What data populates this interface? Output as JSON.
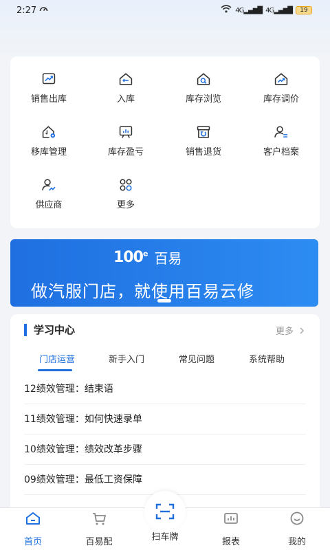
{
  "status_bar": {
    "time": "2:27",
    "signal_1": "4G",
    "signal_2": "4G",
    "battery": "19"
  },
  "menu": {
    "items": [
      {
        "label": "销售出库",
        "icon": "sales-outbound-icon"
      },
      {
        "label": "入库",
        "icon": "inbound-icon"
      },
      {
        "label": "库存浏览",
        "icon": "inventory-browse-icon"
      },
      {
        "label": "库存调价",
        "icon": "inventory-price-icon"
      },
      {
        "label": "移库管理",
        "icon": "transfer-icon"
      },
      {
        "label": "库存盈亏",
        "icon": "inventory-profit-icon"
      },
      {
        "label": "销售退货",
        "icon": "sales-return-icon"
      },
      {
        "label": "客户档案",
        "icon": "customer-file-icon"
      },
      {
        "label": "供应商",
        "icon": "supplier-icon"
      },
      {
        "label": "更多",
        "icon": "more-icon"
      }
    ]
  },
  "banner": {
    "logo_number": "100",
    "logo_sup": "e",
    "logo_brand": "百易",
    "slogan": "做汽服门店，就使用百易云修"
  },
  "learning": {
    "title": "学习中心",
    "more": "更多",
    "tabs": [
      "门店运营",
      "新手入门",
      "常见问题",
      "系统帮助"
    ],
    "articles": [
      "12绩效管理：结束语",
      "11绩效管理：如何快速录单",
      "10绩效管理：绩效改革步骤",
      "09绩效管理：最低工资保障"
    ]
  },
  "nav": {
    "items": [
      {
        "label": "首页",
        "icon": "home-icon"
      },
      {
        "label": "百易配",
        "icon": "cart-icon"
      },
      {
        "label": "扫车牌",
        "icon": "scan-icon"
      },
      {
        "label": "报表",
        "icon": "report-icon"
      },
      {
        "label": "我的",
        "icon": "profile-icon"
      }
    ]
  },
  "colors": {
    "accent": "#1f6fe0",
    "icon_dark": "#333333",
    "icon_blue": "#1f6fe0"
  }
}
